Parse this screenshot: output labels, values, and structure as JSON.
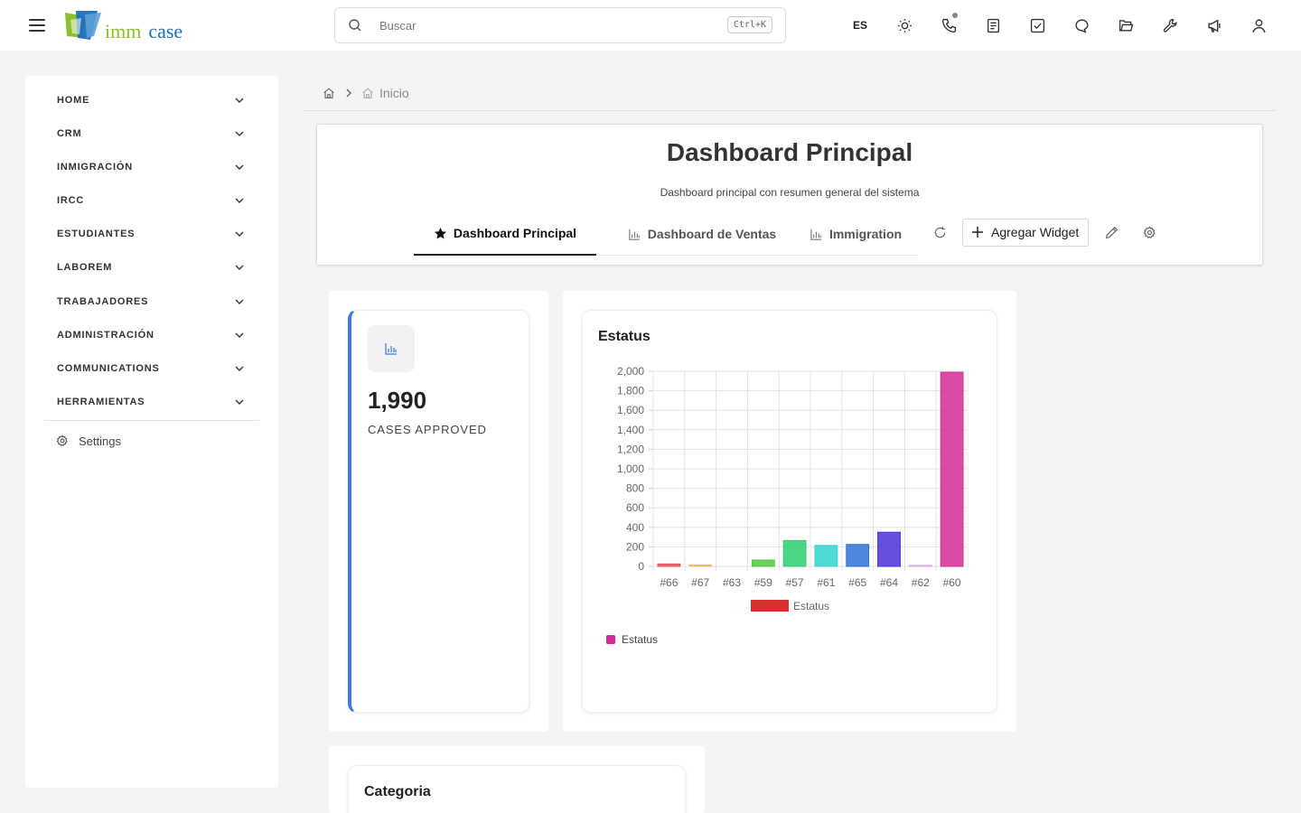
{
  "brand": {
    "part1": "imm",
    "part2": "case"
  },
  "search": {
    "placeholder": "Buscar",
    "shortcut": "Ctrl+K"
  },
  "topbar": {
    "language": "ES",
    "icons": [
      "sun-icon",
      "phone-icon",
      "notes-icon",
      "tasks-icon",
      "chat-icon",
      "folder-icon",
      "tools-icon",
      "megaphone-icon",
      "user-icon"
    ]
  },
  "sidebar": {
    "items": [
      {
        "label": "HOME"
      },
      {
        "label": "CRM"
      },
      {
        "label": "INMIGRACIÓN"
      },
      {
        "label": "IRCC"
      },
      {
        "label": "ESTUDIANTES"
      },
      {
        "label": "LABOREM"
      },
      {
        "label": "TRABAJADORES"
      },
      {
        "label": "ADMINISTRACIÓN"
      },
      {
        "label": "COMMUNICATIONS"
      },
      {
        "label": "HERRAMIENTAS"
      }
    ],
    "settings_label": "Settings"
  },
  "breadcrumb": {
    "current": "Inicio"
  },
  "header": {
    "title": "Dashboard Principal",
    "subtitle": "Dashboard principal con resumen general del sistema",
    "tabs": [
      {
        "label": "Dashboard Principal",
        "active": true
      },
      {
        "label": "Dashboard de Ventas",
        "active": false
      },
      {
        "label": "Immigration",
        "active": false
      }
    ],
    "add_widget_label": "Agregar Widget"
  },
  "widgets": {
    "kpi": {
      "value": "1,990",
      "label": "CASES APPROVED",
      "accent": "#3b7be0"
    },
    "status_chart": {
      "title": "Estatus"
    },
    "category": {
      "title": "Categoria"
    }
  },
  "chart_data": {
    "type": "bar",
    "title": "Estatus",
    "categories": [
      "#66",
      "#67",
      "#63",
      "#59",
      "#57",
      "#61",
      "#65",
      "#64",
      "#62",
      "#60"
    ],
    "series": [
      {
        "name": "Estatus",
        "values": [
          25,
          15,
          0,
          65,
          265,
          215,
          225,
          350,
          10,
          1990
        ]
      }
    ],
    "colors": [
      "#e0505a",
      "#e8b878",
      "#cccccc",
      "#4fc93b",
      "#2ecc71",
      "#2fd4d0",
      "#2f72d8",
      "#4a30d8",
      "#e3a4e8",
      "#d42c96"
    ],
    "legend_swatch_color": "#d63031",
    "ylim": [
      0,
      2000
    ],
    "yticks": [
      0,
      200,
      400,
      600,
      800,
      1000,
      1200,
      1400,
      1600,
      1800,
      2000
    ],
    "ytick_labels": [
      "0",
      "200",
      "400",
      "600",
      "800",
      "1,000",
      "1,200",
      "1,400",
      "1,600",
      "1,800",
      "2,000"
    ],
    "grid": true,
    "legend": "bottom",
    "xlabel": "",
    "ylabel": ""
  }
}
